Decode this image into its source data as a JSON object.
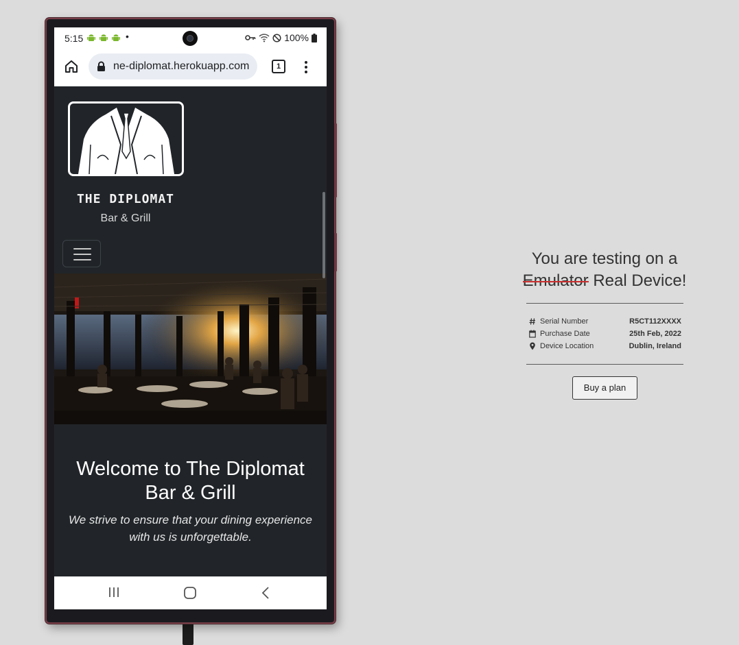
{
  "status_bar": {
    "time": "5:15",
    "notification_icons": [
      "android-icon",
      "android-icon",
      "android-icon"
    ],
    "dot": "•",
    "battery": "100%"
  },
  "browser": {
    "url": "ne-diplomat.herokuapp.com",
    "tab_count": "1"
  },
  "site": {
    "brand_title": "THE DIPLOMAT",
    "brand_subtitle": "Bar & Grill",
    "welcome_heading": "Welcome to The Diplomat Bar & Grill",
    "tagline": "We strive to ensure that your dining experience with us is unforgettable."
  },
  "panel": {
    "title_line1": "You are testing on a",
    "struck_word": "Emulator",
    "real_device": "Real Device!",
    "rows": [
      {
        "icon": "hash-icon",
        "label": "Serial Number",
        "value": "R5CT112XXXX"
      },
      {
        "icon": "calendar-icon",
        "label": "Purchase Date",
        "value": "25th Feb, 2022"
      },
      {
        "icon": "location-pin-icon",
        "label": "Device Location",
        "value": "Dublin, Ireland"
      }
    ],
    "buy_button": "Buy a plan"
  },
  "colors": {
    "page_background": "#dcdcdc",
    "site_background": "#212529",
    "strike_accent": "#cc2f2f",
    "phone_frame": "#7a3f49"
  }
}
